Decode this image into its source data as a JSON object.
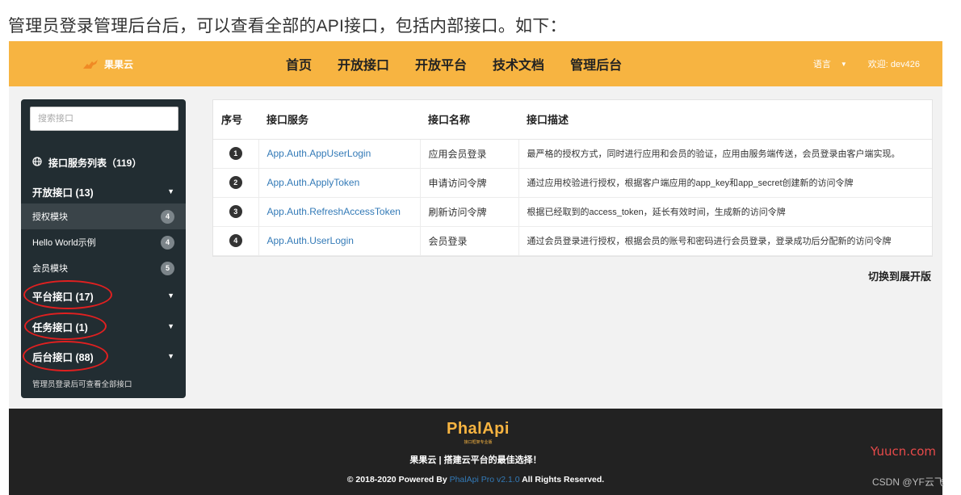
{
  "caption": "管理员登录管理后台后，可以查看全部的API接口，包括内部接口。如下：",
  "navbar": {
    "logo_text": "果果云",
    "links": [
      "首页",
      "开放接口",
      "开放平台",
      "技术文档",
      "管理后台"
    ],
    "language_label": "语言",
    "welcome": "欢迎: dev426",
    "color": "#f7b441"
  },
  "sidebar": {
    "search_placeholder": "搜索接口",
    "title": "接口服务列表（119）",
    "groups": [
      {
        "label": "开放接口 (13)"
      },
      {
        "label": "平台接口 (17)"
      },
      {
        "label": "任务接口 (1)"
      },
      {
        "label": "后台接口 (88)"
      }
    ],
    "subitems": [
      {
        "label": "授权模块",
        "count": "4"
      },
      {
        "label": "Hello World示例",
        "count": "4"
      },
      {
        "label": "会员模块",
        "count": "5"
      }
    ],
    "footer_note": "管理员登录后可查看全部接口"
  },
  "table": {
    "headers": [
      "序号",
      "接口服务",
      "接口名称",
      "接口描述"
    ],
    "rows": [
      {
        "num": "1",
        "service": "App.Auth.AppUserLogin",
        "name": "应用会员登录",
        "desc": "最严格的授权方式，同时进行应用和会员的验证，应用由服务端传送，会员登录由客户端实现。"
      },
      {
        "num": "2",
        "service": "App.Auth.ApplyToken",
        "name": "申请访问令牌",
        "desc": "通过应用校验进行授权，根据客户端应用的app_key和app_secret创建新的访问令牌"
      },
      {
        "num": "3",
        "service": "App.Auth.RefreshAccessToken",
        "name": "刷新访问令牌",
        "desc": "根据已经取到的access_token，延长有效时间，生成新的访问令牌"
      },
      {
        "num": "4",
        "service": "App.Auth.UserLogin",
        "name": "会员登录",
        "desc": "通过会员登录进行授权，根据会员的账号和密码进行会员登录，登录成功后分配新的访问令牌"
      }
    ]
  },
  "switch_label": "切换到展开版",
  "footer": {
    "logo": "PhalApi",
    "logo_sub": "接口框架专业版",
    "slogan": "果果云 | 搭建云平台的最佳选择！",
    "copyright_pre": "© 2018-2020 Powered By",
    "copyright_link": "PhalApi Pro v2.1.0",
    "copyright_post": "All Rights Reserved."
  },
  "watermarks": {
    "site": "Yuucn.com",
    "csdn": "CSDN @YF云飞"
  }
}
